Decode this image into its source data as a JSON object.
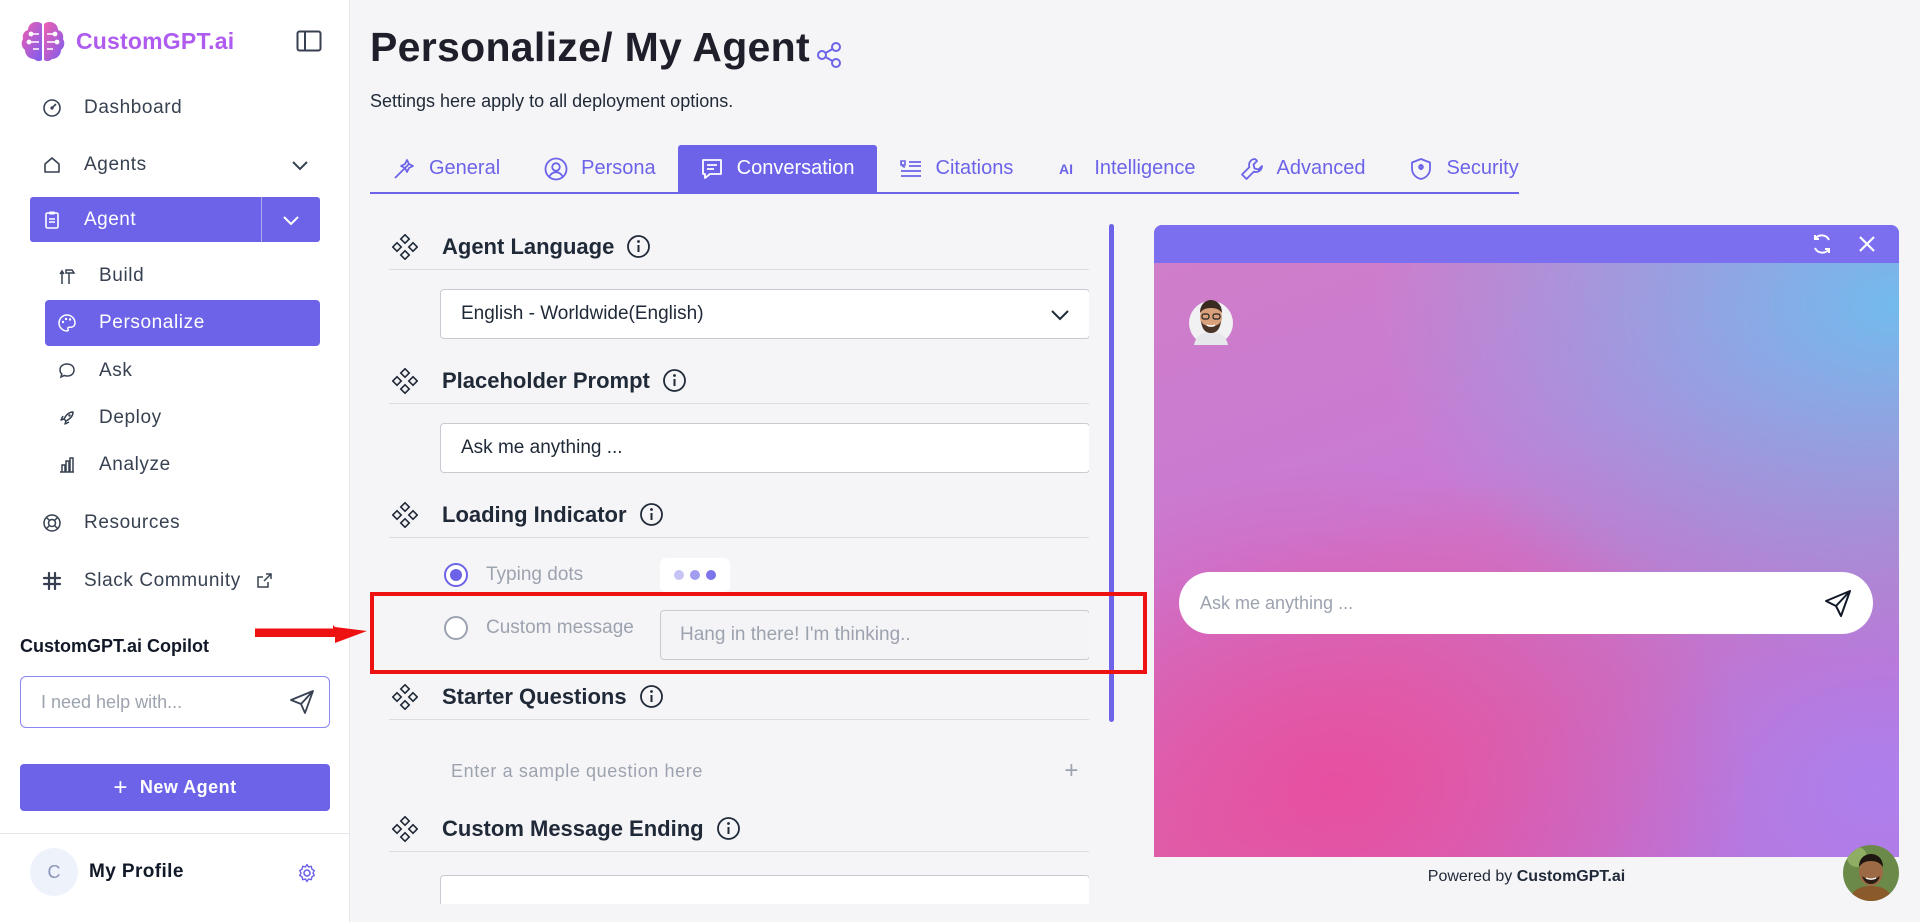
{
  "sidebar": {
    "brand": "CustomGPT.ai",
    "nav": {
      "dashboard": "Dashboard",
      "agents": "Agents",
      "agent": "Agent",
      "resources": "Resources",
      "slack": "Slack Community"
    },
    "sub_items": [
      "Build",
      "Personalize",
      "Ask",
      "Deploy",
      "Analyze"
    ],
    "copilot": {
      "title": "CustomGPT.ai Copilot",
      "placeholder": "I need help with..."
    },
    "new_agent": "New Agent",
    "profile": {
      "initial": "C",
      "name": "My Profile"
    }
  },
  "header": {
    "title": "Personalize/ My Agent",
    "subtitle": "Settings here apply to all deployment options."
  },
  "tabs": [
    {
      "label": "General",
      "icon": "wand-icon"
    },
    {
      "label": "Persona",
      "icon": "user-circle-icon"
    },
    {
      "label": "Conversation",
      "icon": "chat-icon",
      "active": true
    },
    {
      "label": "Citations",
      "icon": "quote-list-icon"
    },
    {
      "label": "Intelligence",
      "icon": "ai-icon"
    },
    {
      "label": "Advanced",
      "icon": "wrench-icon"
    },
    {
      "label": "Security",
      "icon": "shield-icon"
    }
  ],
  "settings": {
    "language": {
      "label": "Agent Language",
      "value": "English - Worldwide(English)"
    },
    "placeholder_prompt": {
      "label": "Placeholder Prompt",
      "value": "Ask me anything ..."
    },
    "loading_indicator": {
      "label": "Loading Indicator",
      "option_typing": "Typing dots",
      "option_custom": "Custom message",
      "custom_placeholder": "Hang in there! I'm thinking..",
      "selected": "Typing dots"
    },
    "starter_questions": {
      "label": "Starter Questions",
      "placeholder": "Enter a sample question here",
      "add_symbol": "+"
    },
    "message_ending": {
      "label": "Custom Message Ending"
    }
  },
  "preview": {
    "input_placeholder": "Ask me anything ...",
    "powered_prefix": "Powered by",
    "powered_brand": "CustomGPT.ai"
  },
  "colors": {
    "accent": "#6c63e8",
    "highlight": "#ee1111"
  }
}
